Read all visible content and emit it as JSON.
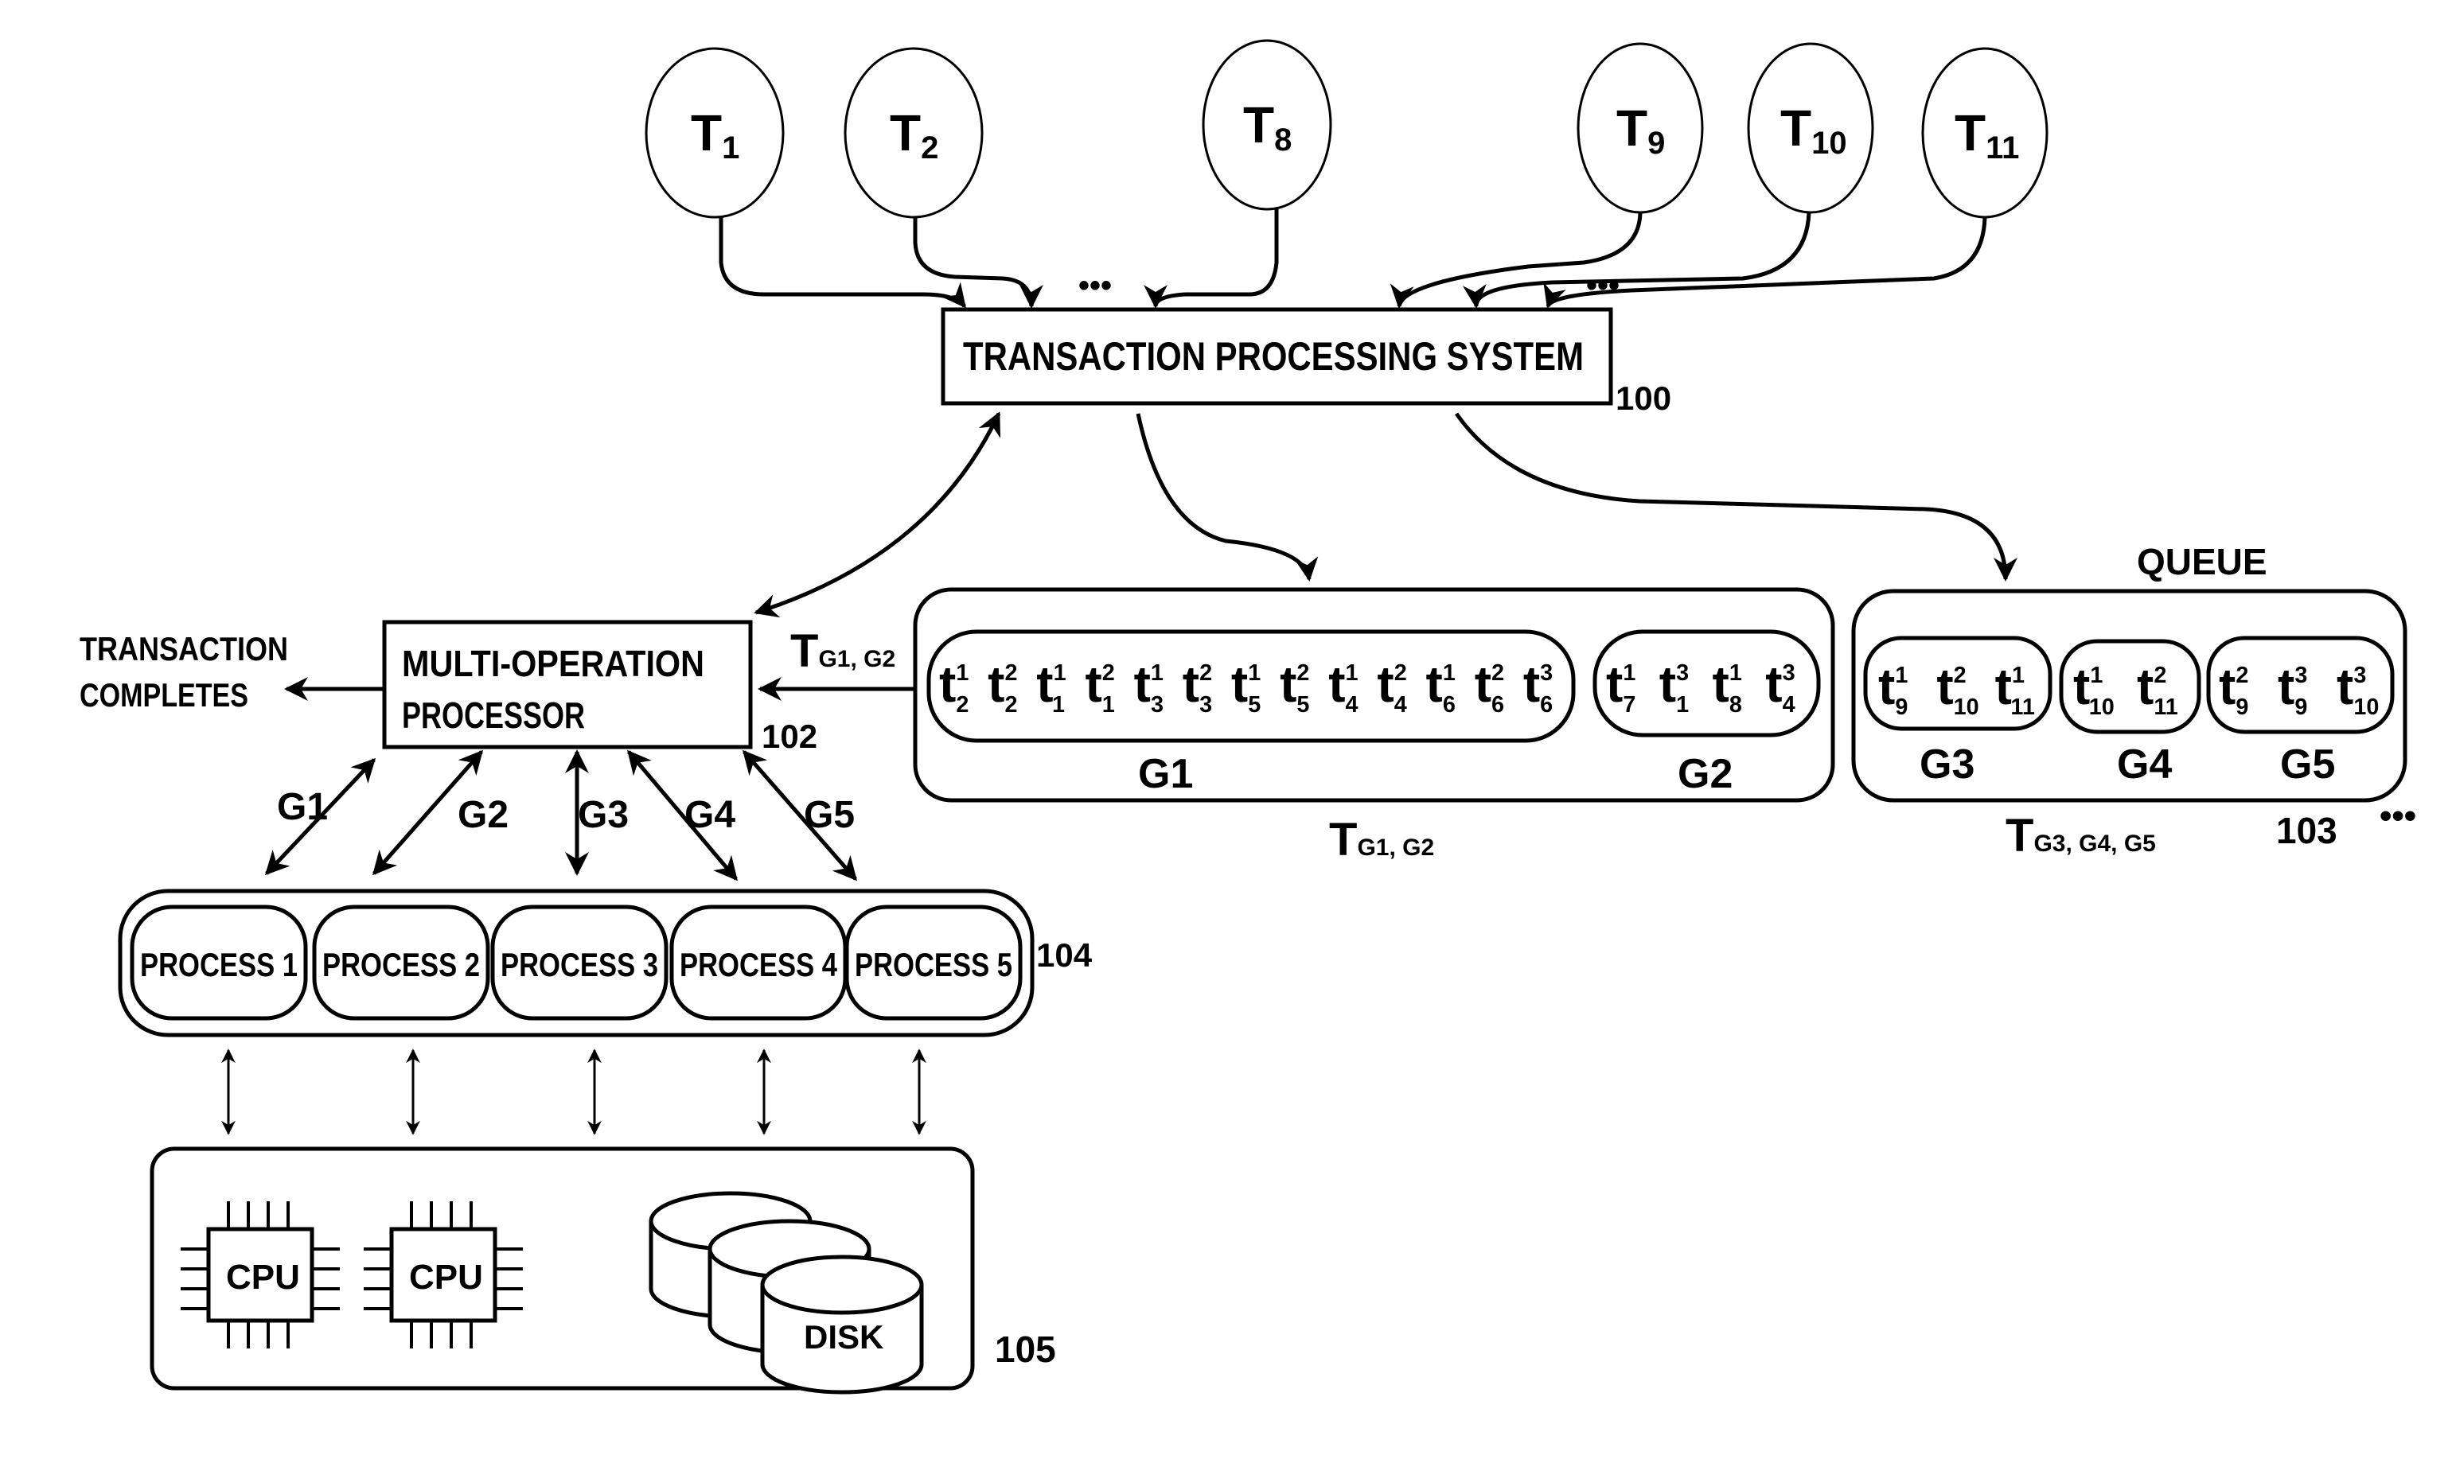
{
  "diagram": {
    "transactions": [
      {
        "name": "T",
        "sub": "1"
      },
      {
        "name": "T",
        "sub": "2"
      },
      {
        "name": "T",
        "sub": "8"
      },
      {
        "name": "T",
        "sub": "9"
      },
      {
        "name": "T",
        "sub": "10"
      },
      {
        "name": "T",
        "sub": "11"
      }
    ],
    "ellipsis": "•••",
    "tps": {
      "label": "TRANSACTION PROCESSING SYSTEM",
      "ref": "100"
    },
    "mop": {
      "line1": "MULTI-OPERATION",
      "line2": "PROCESSOR",
      "ref": "102"
    },
    "completes": {
      "line1": "TRANSACTION",
      "line2": "COMPLETES"
    },
    "batch_label": {
      "main": "T",
      "sub": "G1, G2"
    },
    "batch": {
      "label": {
        "main": "T",
        "sub": "G1, G2"
      },
      "groups": [
        {
          "name": "G1",
          "ops": [
            {
              "sub": "2",
              "sup": "1"
            },
            {
              "sub": "2",
              "sup": "2"
            },
            {
              "sub": "1",
              "sup": "1"
            },
            {
              "sub": "1",
              "sup": "2"
            },
            {
              "sub": "3",
              "sup": "1"
            },
            {
              "sub": "3",
              "sup": "2"
            },
            {
              "sub": "5",
              "sup": "1"
            },
            {
              "sub": "5",
              "sup": "2"
            },
            {
              "sub": "4",
              "sup": "1"
            },
            {
              "sub": "4",
              "sup": "2"
            },
            {
              "sub": "6",
              "sup": "1"
            },
            {
              "sub": "6",
              "sup": "2"
            },
            {
              "sub": "6",
              "sup": "3"
            }
          ]
        },
        {
          "name": "G2",
          "ops": [
            {
              "sub": "7",
              "sup": "1"
            },
            {
              "sub": "1",
              "sup": "3"
            },
            {
              "sub": "8",
              "sup": "1"
            },
            {
              "sub": "4",
              "sup": "3"
            }
          ]
        }
      ]
    },
    "queue": {
      "title": "QUEUE",
      "ref": "103",
      "label": {
        "main": "T",
        "sub": "G3, G4, G5"
      },
      "groups": [
        {
          "name": "G3",
          "ops": [
            {
              "sub": "9",
              "sup": "1"
            },
            {
              "sub": "10",
              "sup": "2"
            },
            {
              "sub": "11",
              "sup": "1"
            }
          ]
        },
        {
          "name": "G4",
          "ops": [
            {
              "sub": "10",
              "sup": "1"
            },
            {
              "sub": "11",
              "sup": "2"
            }
          ]
        },
        {
          "name": "G5",
          "ops": [
            {
              "sub": "9",
              "sup": "2"
            },
            {
              "sub": "9",
              "sup": "3"
            },
            {
              "sub": "10",
              "sup": "3"
            }
          ]
        }
      ]
    },
    "group_links": [
      "G1",
      "G2",
      "G3",
      "G4",
      "G5"
    ],
    "processes": {
      "ref": "104",
      "items": [
        "PROCESS 1",
        "PROCESS 2",
        "PROCESS 3",
        "PROCESS 4",
        "PROCESS 5"
      ]
    },
    "resources": {
      "ref": "105",
      "cpu_label": "CPU",
      "disk_label": "DISK"
    }
  }
}
